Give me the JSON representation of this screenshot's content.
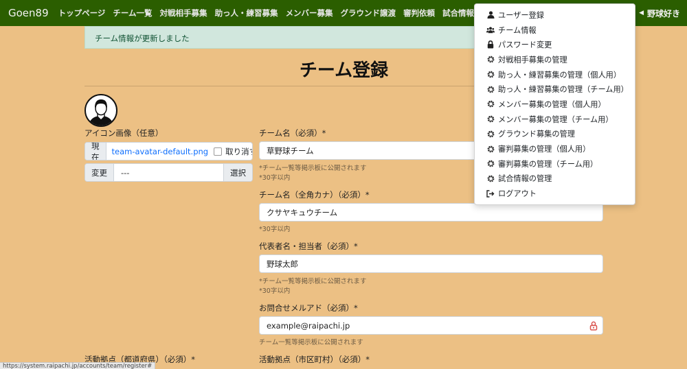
{
  "nav": {
    "brand": "Goen89",
    "links": [
      "トップページ",
      "チーム一覧",
      "対戦相手募集",
      "助っ人・練習募集",
      "メンバー募集",
      "グラウンド譲渡",
      "審判依頼",
      "試合情報"
    ],
    "user": "野球好き"
  },
  "alert": "チーム情報が更新しました",
  "page_title": "チーム登録",
  "icon_section": {
    "label": "アイコン画像（任意）",
    "current_label": "現在",
    "current_file": "team-avatar-default.png",
    "clear_label": "取り消す",
    "change_label": "変更",
    "file_value": "---",
    "select_button": "選択"
  },
  "fields": {
    "team_name": {
      "label": "チーム名（必須）*",
      "value": "草野球チーム",
      "hint1": "*チーム一覧等掲示板に公開されます",
      "hint2": "*30字以内"
    },
    "team_kana": {
      "label": "チーム名（全角カナ）（必須）*",
      "value": "クサヤキュウチーム",
      "hint1": "*30字以内"
    },
    "representative": {
      "label": "代表者名・担当者（必須）*",
      "value": "野球太郎",
      "hint1": "*チーム一覧等掲示板に公開されます",
      "hint2": "*30字以内"
    },
    "email": {
      "label": "お問合せメルアド（必須）*",
      "value": "example@raipachi.jp",
      "hint1": "チーム一覧等掲示板に公開されます"
    },
    "prefecture": {
      "label": "活動拠点（都道府県）（必須）*"
    },
    "city": {
      "label": "活動拠点（市区町村）（必須）*"
    }
  },
  "dropdown": {
    "items": [
      {
        "label": "ユーザー登録",
        "icon": "user-icon"
      },
      {
        "label": "チーム情報",
        "icon": "users-icon"
      },
      {
        "label": "パスワード変更",
        "icon": "lock-icon"
      },
      {
        "label": "対戦相手募集の管理",
        "icon": "gear-icon"
      },
      {
        "label": "助っ人・練習募集の管理（個人用）",
        "icon": "gear-icon"
      },
      {
        "label": "助っ人・練習募集の管理（チーム用）",
        "icon": "gear-icon"
      },
      {
        "label": "メンバー募集の管理（個人用）",
        "icon": "gear-icon"
      },
      {
        "label": "メンバー募集の管理（チーム用）",
        "icon": "gear-icon"
      },
      {
        "label": "グラウンド募集の管理",
        "icon": "gear-icon"
      },
      {
        "label": "審判募集の管理（個人用）",
        "icon": "gear-icon"
      },
      {
        "label": "審判募集の管理（チーム用）",
        "icon": "gear-icon"
      },
      {
        "label": "試合情報の管理",
        "icon": "gear-icon"
      },
      {
        "label": "ログアウト",
        "icon": "logout-icon"
      }
    ]
  },
  "status_url": "https://system.raipachi.jp/accounts/team/register#"
}
